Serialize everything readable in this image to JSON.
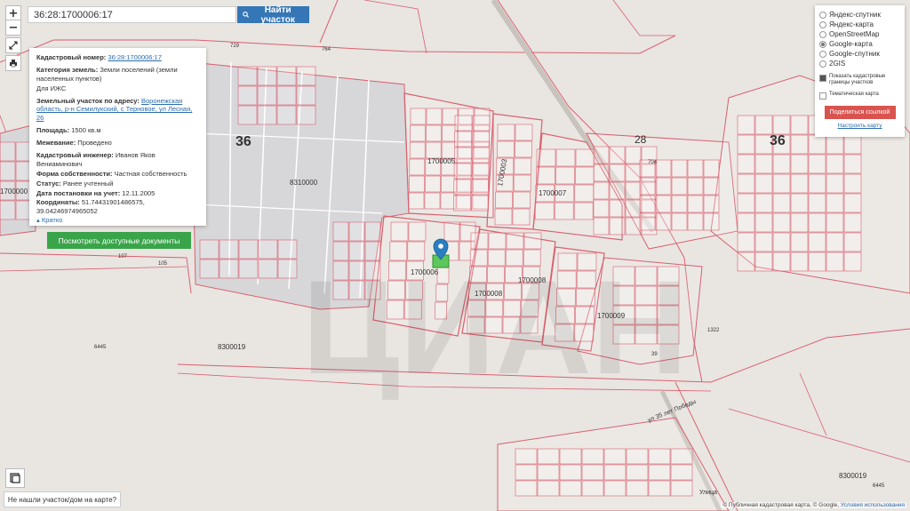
{
  "search": {
    "value": "36:28:1700006:17",
    "button_label": "Найти участок"
  },
  "zoom": {
    "in_label": "+",
    "out_label": "−"
  },
  "info": {
    "cadastral_number_label": "Кадастровый номер:",
    "cadastral_number": "36:28:1700006:17",
    "land_category_label": "Категория земель:",
    "land_category": "Земли поселений (земли населенных пунктов)",
    "usage": "Для ИЖС",
    "address_label": "Земельный участок по адресу:",
    "address": "Воронежская область, р-н Семилукский, с Терновое, ул Лесная, 26",
    "area_label": "Площадь:",
    "area": "1500 кв.м",
    "survey_label": "Межевание:",
    "survey": "Проведено",
    "engineer_label": "Кадастровый инженер:",
    "engineer": "Иванов Яков Вениаминович",
    "ownership_label": "Форма собственности:",
    "ownership": "Частная собственность",
    "status_label": "Статус:",
    "status": "Ранее учтенный",
    "date_label": "Дата постановки на учет:",
    "date": "12.11.2005",
    "coords_label": "Координаты:",
    "coords": "51.74431901486575, 39.04246974965052",
    "collapse_label": "Кратко",
    "docs_button": "Посмотреть доступные документы"
  },
  "layers": {
    "options": [
      {
        "label": "Яндекс-спутник",
        "selected": false
      },
      {
        "label": "Яндекс-карта",
        "selected": false
      },
      {
        "label": "OpenStreetMap",
        "selected": false
      },
      {
        "label": "Google-карта",
        "selected": true
      },
      {
        "label": "Google-спутник",
        "selected": false
      },
      {
        "label": "2GIS",
        "selected": false
      }
    ],
    "show_cadastral": "Показать кадастровые границы участков",
    "show_cadastral_checked": true,
    "thematic": "Тематическая карта",
    "thematic_checked": false,
    "share_button": "Поделиться ссылкой",
    "configure_link": "Настроить карту"
  },
  "map_labels": {
    "region_left": "36",
    "region_right": "36",
    "block_28": "28",
    "q_8310000": "8310000",
    "q_1700005": "1700005",
    "q_1700003": "1700003",
    "q_1700007": "1700007",
    "q_1700006": "1700006",
    "q_1700008": "1700008",
    "q_1700009": "1700009",
    "q_8300019a": "8300019",
    "q_8300019b": "8300019",
    "q_1700000": "1700000",
    "road_label": "ул 35 лет Победы",
    "street_label": "Улица",
    "num_729": "729",
    "num_764": "764",
    "num_107": "107",
    "num_105": "105",
    "num_6445a": "6445",
    "num_6445b": "6445",
    "num_1322": "1322",
    "num_39": "39",
    "num_704": "704"
  },
  "colors": {
    "parcel_stroke": "#d9606e",
    "parcel_fill": "rgba(255,255,255,0.18)",
    "selected_fill": "#5cc85c",
    "marker": "#2a7fc1",
    "bg": "#e9e5e1",
    "built": "#d7d7da"
  },
  "not_found_label": "Не нашли участок/дом на карте?",
  "attribution": {
    "prefix": "© Публичная кадастровая карта, © Google,",
    "terms": "Условия использования"
  }
}
